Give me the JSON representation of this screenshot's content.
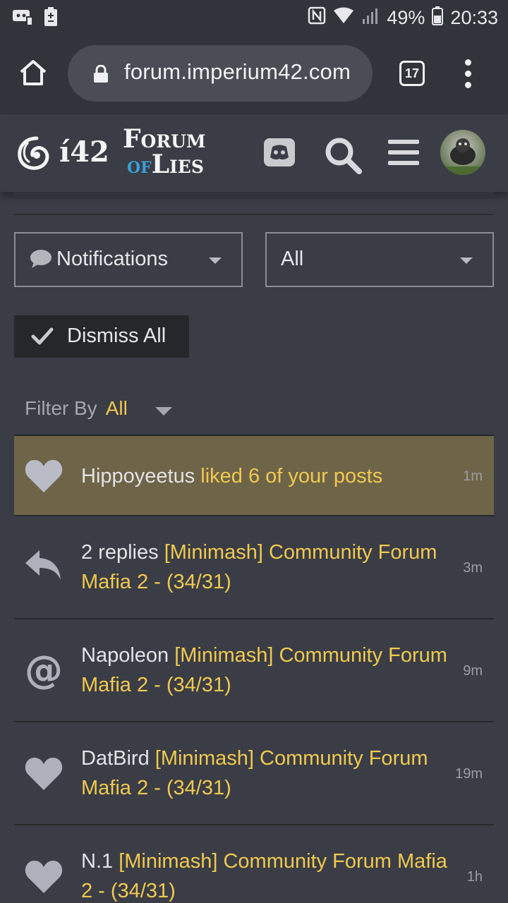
{
  "status_bar": {
    "battery": "49%",
    "time": "20:33"
  },
  "browser": {
    "url": "forum.imperium42.com",
    "tab_count": "17"
  },
  "site": {
    "logo_text": "í42",
    "forum_logo_line1": "Forum",
    "forum_logo_of": "OF",
    "forum_logo_line2": "Lies"
  },
  "filters": {
    "type_select": "Notifications",
    "scope_select": "All",
    "dismiss_label": "Dismiss All",
    "filter_by_label": "Filter By",
    "filter_by_value": "All"
  },
  "notifications": [
    {
      "icon": "heart-icon",
      "user": "Hippoyeetus",
      "action": "liked 6 of your posts",
      "time": "1m",
      "unread": true
    },
    {
      "icon": "reply-icon",
      "user": "2 replies",
      "action": "[Minimash] Community Forum Mafia 2 - (34/31)",
      "time": "3m",
      "unread": false
    },
    {
      "icon": "mention-icon",
      "user": "Napoleon",
      "action": "[Minimash] Community Forum Mafia 2 - (34/31)",
      "time": "9m",
      "unread": false
    },
    {
      "icon": "heart-icon",
      "user": "DatBird",
      "action": "[Minimash] Community Forum Mafia 2 - (34/31)",
      "time": "19m",
      "unread": false
    },
    {
      "icon": "heart-icon",
      "user": "N.1",
      "action": "[Minimash] Community Forum Mafia 2 - (34/31)",
      "time": "1h",
      "unread": false
    }
  ],
  "colors": {
    "accent": "#f1c94f",
    "unread_bg": "#6e6448",
    "background": "#3a3d45"
  }
}
